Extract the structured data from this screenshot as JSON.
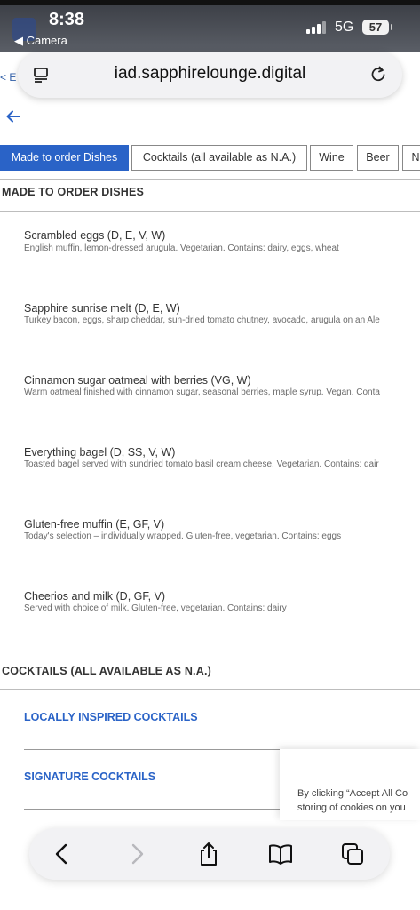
{
  "status_bar": {
    "time": "8:38",
    "back_app": "◀ Camera",
    "network": "5G",
    "battery": "57"
  },
  "browser": {
    "url": "iad.sapphirelounge.digital",
    "peek_back": "< E"
  },
  "tabs": [
    {
      "label": "Made to order Dishes",
      "active": true
    },
    {
      "label": "Cocktails (all available as N.A.)",
      "active": false
    },
    {
      "label": "Wine",
      "active": false
    },
    {
      "label": "Beer",
      "active": false
    },
    {
      "label": "N",
      "active": false
    }
  ],
  "made_to_order": {
    "title": "MADE TO ORDER DISHES",
    "items": [
      {
        "name": "Scrambled eggs (D, E, V, W)",
        "desc": "English muffin, lemon-dressed arugula. Vegetarian. Contains: dairy, eggs, wheat"
      },
      {
        "name": "Sapphire sunrise melt (D, E, W)",
        "desc": "Turkey bacon, eggs, sharp cheddar, sun-dried tomato chutney, avocado, arugula on an Ale"
      },
      {
        "name": "Cinnamon sugar oatmeal with berries (VG, W)",
        "desc": "Warm oatmeal finished with cinnamon sugar, seasonal berries, maple syrup. Vegan. Conta"
      },
      {
        "name": "Everything bagel (D, SS, V, W)",
        "desc": "Toasted bagel served with sundried tomato basil cream cheese. Vegetarian. Contains: dair"
      },
      {
        "name": "Gluten-free muffin (E, GF, V)",
        "desc": "Today's selection – individually wrapped. Gluten-free, vegetarian. Contains: eggs"
      },
      {
        "name": "Cheerios and milk (D, GF, V)",
        "desc": "Served with choice of milk. Gluten-free, vegetarian. Contains: dairy"
      }
    ]
  },
  "cocktails": {
    "title": "COCKTAILS (ALL AVAILABLE AS N.A.)",
    "links": [
      "LOCALLY INSPIRED COCKTAILS",
      "SIGNATURE COCKTAILS"
    ]
  },
  "cookie_banner": {
    "line1": "By clicking “Accept All Co",
    "line2": "storing of cookies on you"
  },
  "colors": {
    "accent": "#2a63c7",
    "status_bar": "#4a4e56"
  }
}
